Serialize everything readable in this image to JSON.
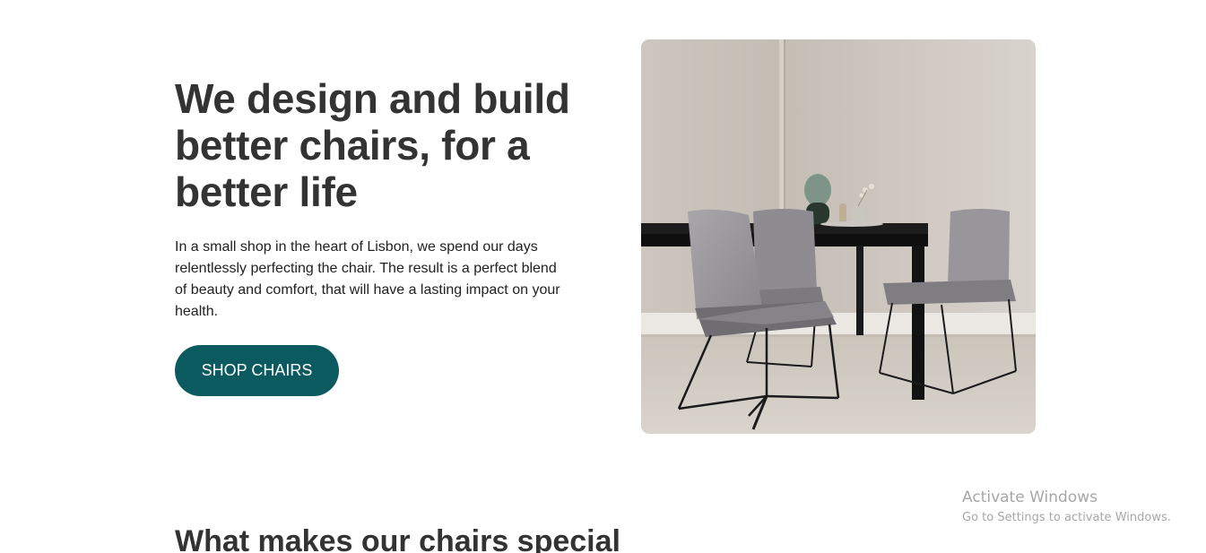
{
  "hero": {
    "title": "We design and build better chairs, for a better life",
    "description": "In a small shop in the heart of Lisbon, we spend our days relentlessly perfecting the chair. The result is a perfect blend of beauty and comfort, that will have a lasting impact on your health.",
    "button_label": "SHOP CHAIRS",
    "image_alt": "Dining table with grey upholstered chairs"
  },
  "section": {
    "title": "What makes our chairs special"
  },
  "watermark": {
    "title": "Activate Windows",
    "subtitle": "Go to Settings to activate Windows."
  },
  "colors": {
    "primary": "#0a5a60",
    "text": "#333333",
    "background": "#ffffff"
  }
}
